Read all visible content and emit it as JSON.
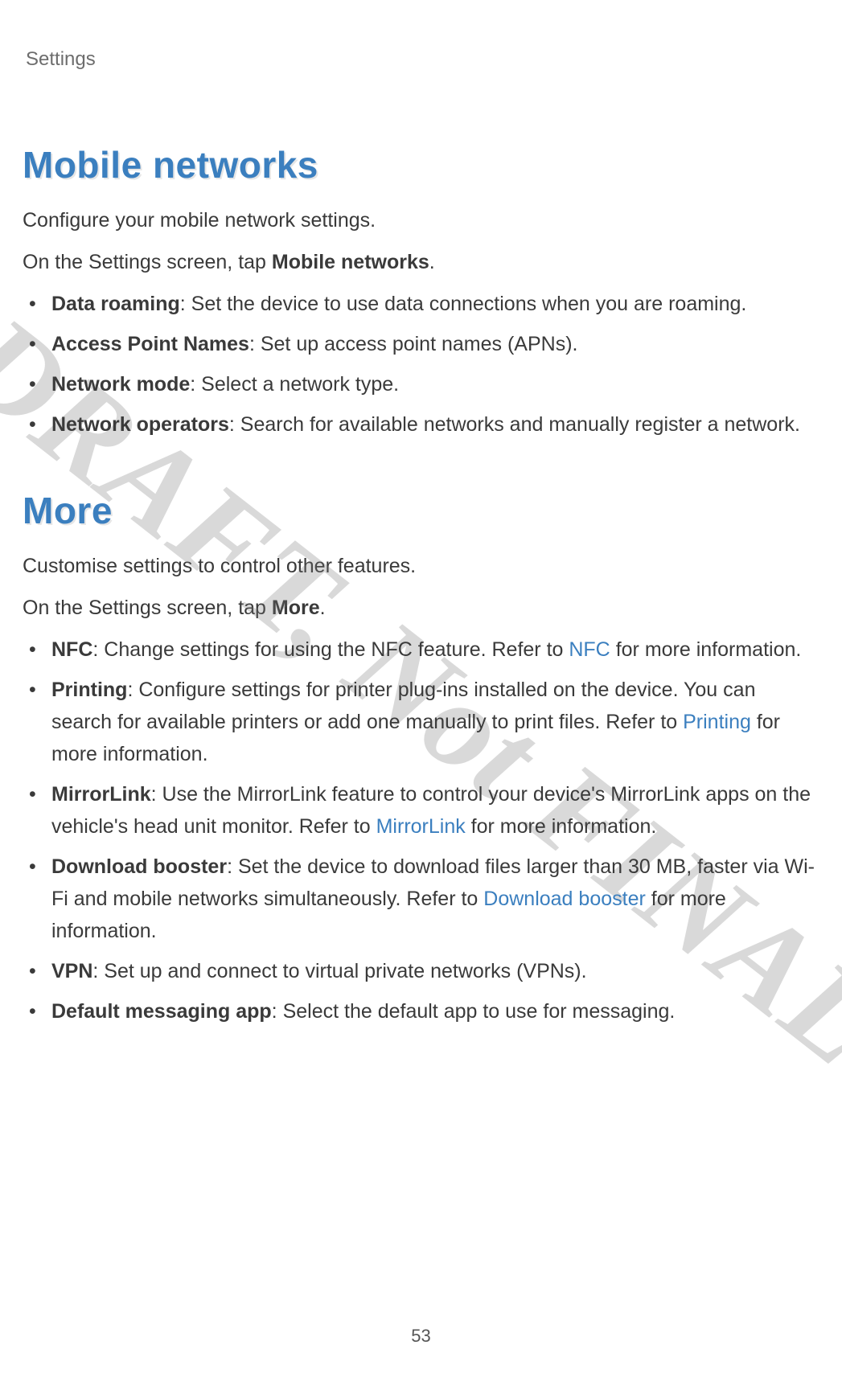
{
  "header": "Settings",
  "page_number": "53",
  "watermark": "DRAFT, Not FINAL",
  "sections": [
    {
      "title": "Mobile networks",
      "paragraphs": [
        {
          "runs": [
            {
              "text": "Configure your mobile network settings."
            }
          ]
        },
        {
          "runs": [
            {
              "text": "On the Settings screen, tap "
            },
            {
              "text": "Mobile networks",
              "bold": true
            },
            {
              "text": "."
            }
          ]
        }
      ],
      "bullets": [
        {
          "runs": [
            {
              "text": "Data roaming",
              "bold": true
            },
            {
              "text": ": Set the device to use data connections when you are roaming."
            }
          ]
        },
        {
          "runs": [
            {
              "text": "Access Point Names",
              "bold": true
            },
            {
              "text": ": Set up access point names (APNs)."
            }
          ]
        },
        {
          "runs": [
            {
              "text": "Network mode",
              "bold": true
            },
            {
              "text": ": Select a network type."
            }
          ]
        },
        {
          "runs": [
            {
              "text": "Network operators",
              "bold": true
            },
            {
              "text": ": Search for available networks and manually register a network."
            }
          ]
        }
      ]
    },
    {
      "title": "More",
      "paragraphs": [
        {
          "runs": [
            {
              "text": "Customise settings to control other features."
            }
          ]
        },
        {
          "runs": [
            {
              "text": "On the Settings screen, tap "
            },
            {
              "text": "More",
              "bold": true
            },
            {
              "text": "."
            }
          ]
        }
      ],
      "bullets": [
        {
          "runs": [
            {
              "text": "NFC",
              "bold": true
            },
            {
              "text": ": Change settings for using the NFC feature. Refer to "
            },
            {
              "text": "NFC",
              "link": true
            },
            {
              "text": " for more information."
            }
          ]
        },
        {
          "runs": [
            {
              "text": "Printing",
              "bold": true
            },
            {
              "text": ": Configure settings for printer plug-ins installed on the device. You can search for available printers or add one manually to print files. Refer to "
            },
            {
              "text": "Printing",
              "link": true
            },
            {
              "text": " for more information."
            }
          ]
        },
        {
          "runs": [
            {
              "text": "MirrorLink",
              "bold": true
            },
            {
              "text": ": Use the MirrorLink feature to control your device's MirrorLink apps on the vehicle's head unit monitor. Refer to "
            },
            {
              "text": "MirrorLink",
              "link": true
            },
            {
              "text": " for more information."
            }
          ]
        },
        {
          "runs": [
            {
              "text": "Download booster",
              "bold": true
            },
            {
              "text": ": Set the device to download files larger than 30 MB, faster via Wi-Fi and mobile networks simultaneously. Refer to "
            },
            {
              "text": "Download booster",
              "link": true
            },
            {
              "text": " for more information."
            }
          ]
        },
        {
          "runs": [
            {
              "text": "VPN",
              "bold": true
            },
            {
              "text": ": Set up and connect to virtual private networks (VPNs)."
            }
          ]
        },
        {
          "runs": [
            {
              "text": "Default messaging app",
              "bold": true
            },
            {
              "text": ": Select the default app to use for messaging."
            }
          ]
        }
      ]
    }
  ]
}
